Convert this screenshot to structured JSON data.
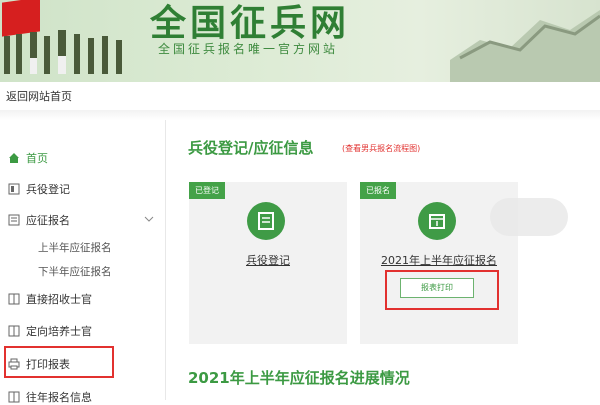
{
  "banner": {
    "title": "全国征兵网",
    "subtitle": "全国征兵报名唯一官方网站"
  },
  "nav": {
    "back_home": "返回网站首页"
  },
  "sidebar": {
    "items": [
      {
        "label": "首页",
        "icon": "home-icon"
      },
      {
        "label": "兵役登记",
        "icon": "id-card-icon"
      },
      {
        "label": "应征报名",
        "icon": "form-icon"
      },
      {
        "label": "直接招收士官",
        "icon": "book-icon"
      },
      {
        "label": "定向培养士官",
        "icon": "book-icon"
      },
      {
        "label": "打印报表",
        "icon": "printer-icon"
      },
      {
        "label": "往年报名信息",
        "icon": "book-icon"
      }
    ],
    "sub_items": [
      "上半年应征报名",
      "下半年应征报名"
    ]
  },
  "main": {
    "section_title": "兵役登记/应征信息",
    "section_note": "(查看男兵报名流程图)",
    "cards": [
      {
        "tag": "已登记",
        "label": "兵役登记"
      },
      {
        "tag": "已报名",
        "label": "2021年上半年应征报名",
        "button": "报表打印"
      }
    ],
    "progress_title": "2021年上半年应征报名进展情况"
  },
  "colors": {
    "accent": "#3c9a43",
    "highlight": "#e2312f",
    "flag": "#d61f1f"
  }
}
